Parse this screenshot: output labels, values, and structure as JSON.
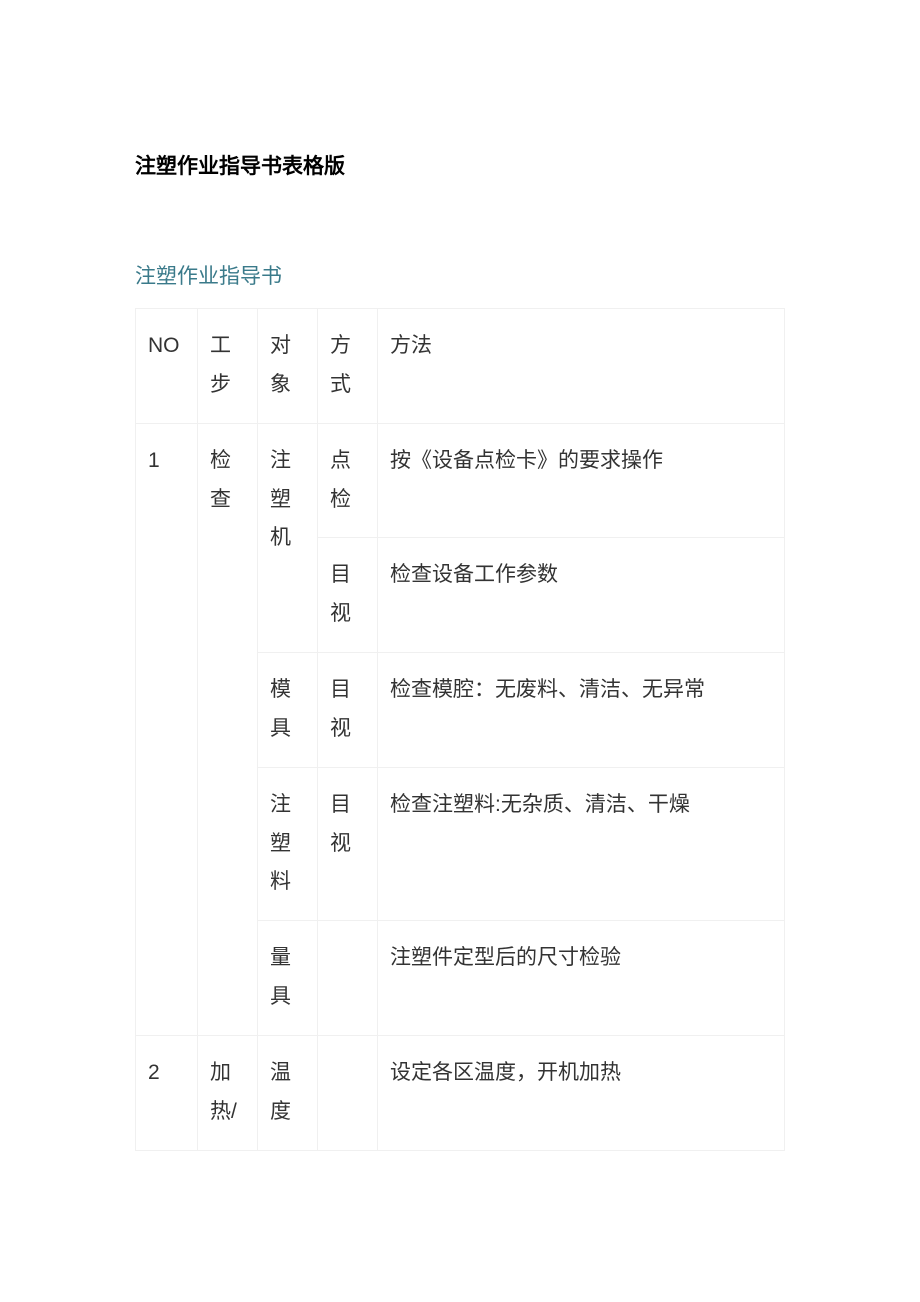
{
  "titles": {
    "main": "注塑作业指导书表格版",
    "sub": "注塑作业指导书"
  },
  "headers": {
    "no": "NO",
    "step": "工步",
    "object": "对象",
    "mode": "方式",
    "method": "方法"
  },
  "rows": [
    {
      "no": "1",
      "step": "检查",
      "object": "注塑机",
      "mode": "点检",
      "method": "按《设备点检卡》的要求操作"
    },
    {
      "mode": "目视",
      "method": "检查设备工作参数"
    },
    {
      "object": "模具",
      "mode": "目视",
      "method": "检查模腔：无废料、清洁、无异常"
    },
    {
      "object": "注塑料",
      "mode": "目视",
      "method": "检查注塑料:无杂质、清洁、干燥"
    },
    {
      "object": "量具",
      "mode": "",
      "method": "注塑件定型后的尺寸检验"
    },
    {
      "no": "2",
      "step": "加热/",
      "object": "温度",
      "mode": "",
      "method": "设定各区温度，开机加热"
    }
  ]
}
